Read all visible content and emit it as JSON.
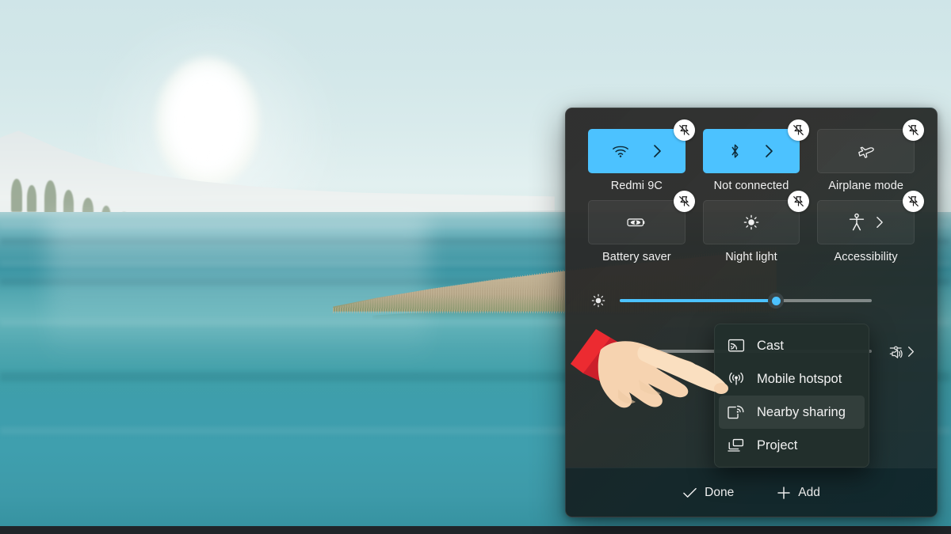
{
  "wallpaper": {
    "description": "Lakeside landscape with sun over water and reeds",
    "sky_color": "#d6e9ea",
    "water_color": "#3f9fae",
    "reed_color": "#c5b597"
  },
  "quick_settings": {
    "accent_color": "#4cc2ff",
    "panel_color": "#292929",
    "tiles": [
      {
        "id": "wifi",
        "label": "Redmi 9C",
        "icon": "wifi-icon",
        "state": "on",
        "has_chevron": true,
        "pinned": true
      },
      {
        "id": "bluetooth",
        "label": "Not connected",
        "icon": "bluetooth-icon",
        "state": "on",
        "has_chevron": true,
        "pinned": true
      },
      {
        "id": "airplane",
        "label": "Airplane mode",
        "icon": "airplane-icon",
        "state": "off",
        "has_chevron": false,
        "pinned": true
      },
      {
        "id": "battery",
        "label": "Battery saver",
        "icon": "battery-saver-icon",
        "state": "off",
        "has_chevron": false,
        "pinned": true
      },
      {
        "id": "nightlight",
        "label": "Night light",
        "icon": "brightness-icon",
        "state": "off",
        "has_chevron": false,
        "pinned": true
      },
      {
        "id": "accessibility",
        "label": "Accessibility",
        "icon": "accessibility-icon",
        "state": "off",
        "has_chevron": true,
        "pinned": true
      }
    ],
    "unpin_tooltip": "Unpin",
    "sliders": [
      {
        "id": "brightness",
        "icon": "brightness-icon",
        "value": 62,
        "label": "Brightness"
      },
      {
        "id": "volume",
        "icon": "volume-mute-icon",
        "value": 3,
        "label": "Volume",
        "right_icon": "audio-output-icon"
      }
    ],
    "footer": {
      "done_label": "Done",
      "done_icon": "check-icon",
      "add_label": "Add",
      "add_icon": "plus-icon"
    }
  },
  "context_menu": {
    "items": [
      {
        "label": "Cast",
        "icon": "cast-icon",
        "selected": false
      },
      {
        "label": "Mobile hotspot",
        "icon": "mobile-hotspot-icon",
        "selected": false
      },
      {
        "label": "Nearby sharing",
        "icon": "nearby-sharing-icon",
        "selected": true
      },
      {
        "label": "Project",
        "icon": "project-icon",
        "selected": false
      }
    ]
  },
  "cursor": {
    "type": "pointing-hand",
    "sleeve_color": "#e8232a",
    "skin_color": "#f6d3b0"
  }
}
